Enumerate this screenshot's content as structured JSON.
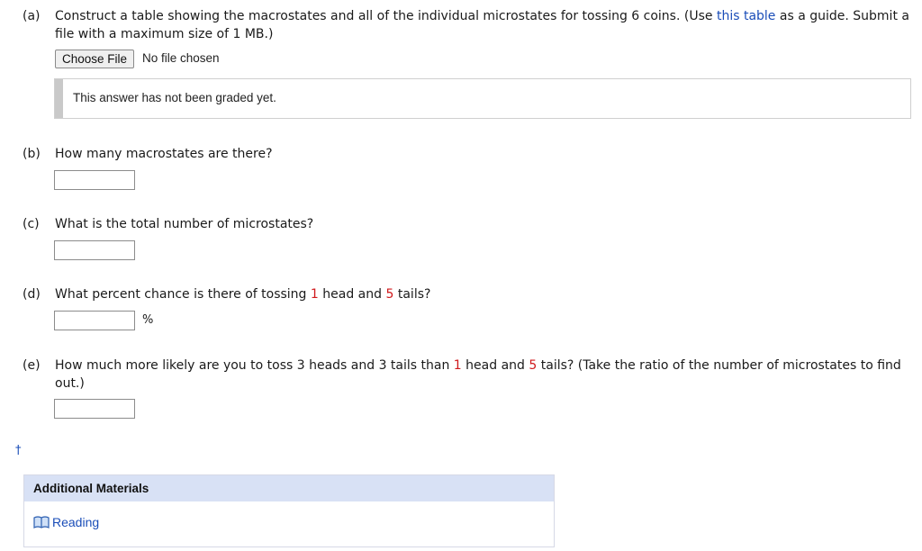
{
  "parts": {
    "a": {
      "label": "(a)",
      "text_1": "Construct a table showing the macrostates and all of the individual microstates for tossing 6 coins. (Use ",
      "link": "this table",
      "text_2": " as a guide. Submit a file with a maximum size of 1 MB.)",
      "choose_file": "Choose File",
      "no_file": "No file chosen",
      "graded_note": "This answer has not been graded yet."
    },
    "b": {
      "label": "(b)",
      "question": "How many macrostates are there?",
      "answer": ""
    },
    "c": {
      "label": "(c)",
      "question": "What is the total number of microstates?",
      "answer": ""
    },
    "d": {
      "label": "(d)",
      "q1": "What percent chance is there of tossing ",
      "num1": "1",
      "q2": " head and ",
      "num2": "5",
      "q3": " tails?",
      "answer": "",
      "unit": "%"
    },
    "e": {
      "label": "(e)",
      "q1": "How much more likely are you to toss 3 heads and 3 tails than ",
      "num1": "1",
      "q2": " head and ",
      "num2": "5",
      "q3": " tails? (Take the ratio of the number of microstates to find out.)",
      "answer": ""
    }
  },
  "footnote_mark": "†",
  "additional_materials": {
    "title": "Additional Materials",
    "reading": "Reading",
    "icon": "book-icon"
  },
  "colors": {
    "link": "#1a4db8",
    "highlight_number": "#d0191c",
    "panel_header": "#d8e1f5"
  }
}
